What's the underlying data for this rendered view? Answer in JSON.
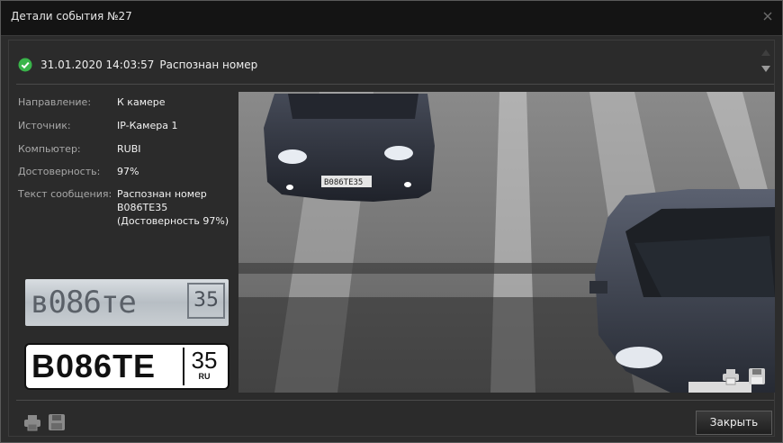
{
  "window": {
    "title": "Детали события №27"
  },
  "event": {
    "timestamp": "31.01.2020 14:03:57",
    "text": "Распознан номер"
  },
  "details": [
    {
      "label": "Направление:",
      "value": [
        "К камере"
      ]
    },
    {
      "label": "Источник:",
      "value": [
        "IP-Камера 1"
      ]
    },
    {
      "label": "Компьютер:",
      "value": [
        "RUBI"
      ]
    },
    {
      "label": "Достоверность:",
      "value": [
        "97%"
      ]
    },
    {
      "label": "Текст сообщения:",
      "value": [
        "Распознан номер",
        "B086TE35",
        "(Достоверность 97%)"
      ]
    }
  ],
  "plate_crop": {
    "number": "в086те",
    "region": "35"
  },
  "plate": {
    "number": "B086TE",
    "region": "35",
    "country": "RU"
  },
  "photo": {
    "plate_text": "B086TE35"
  },
  "buttons": {
    "close": "Закрыть"
  },
  "icons": [
    "check-icon",
    "close-icon",
    "scroll-up-icon",
    "scroll-down-icon",
    "print-icon",
    "save-icon"
  ]
}
